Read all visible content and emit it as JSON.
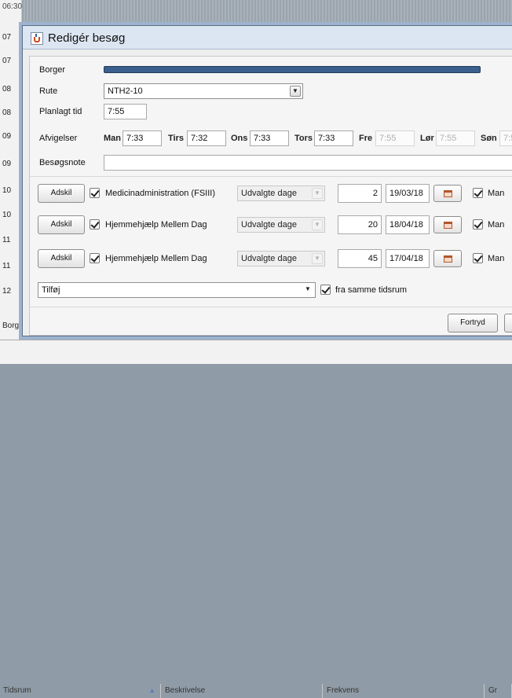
{
  "background": {
    "times": [
      "06:30",
      "07",
      "07",
      "08",
      "08",
      "09",
      "09",
      "10",
      "10",
      "11",
      "11",
      "12",
      "Borg"
    ],
    "table_headers": [
      "Tidsrum",
      "Beskrivelse",
      "Frekvens",
      "Gr"
    ]
  },
  "dialog": {
    "title": "Redigér besøg",
    "labels": {
      "borger": "Borger",
      "rute": "Rute",
      "planlagt": "Planlagt tid",
      "afvigelser": "Afvigelser",
      "note": "Besøgsnote"
    },
    "rute_value": "NTH2-10",
    "planlagt_value": "7:55",
    "deviations": [
      {
        "day": "Man",
        "time": "7:33",
        "enabled": true
      },
      {
        "day": "Tirs",
        "time": "7:32",
        "enabled": true
      },
      {
        "day": "Ons",
        "time": "7:33",
        "enabled": true
      },
      {
        "day": "Tors",
        "time": "7:33",
        "enabled": true
      },
      {
        "day": "Fre",
        "time": "7:55",
        "enabled": false
      },
      {
        "day": "Lør",
        "time": "7:55",
        "enabled": false
      },
      {
        "day": "Søn",
        "time": "7:5",
        "enabled": false
      }
    ],
    "note_value": "",
    "tasks": [
      {
        "button": "Adskil",
        "checked": true,
        "name": "Medicinadministration (FSIII)",
        "frequency": "Udvalgte dage",
        "count": "2",
        "date": "19/03/18",
        "day_checked": true,
        "day": "Man"
      },
      {
        "button": "Adskil",
        "checked": true,
        "name": "Hjemmehjælp Mellem Dag",
        "frequency": "Udvalgte dage",
        "count": "20",
        "date": "18/04/18",
        "day_checked": true,
        "day": "Man"
      },
      {
        "button": "Adskil",
        "checked": true,
        "name": "Hjemmehjælp Mellem Dag",
        "frequency": "Udvalgte dage",
        "count": "45",
        "date": "17/04/18",
        "day_checked": true,
        "day": "Man"
      }
    ],
    "add_combo": "Tilføj",
    "same_timespan_label": "fra samme tidsrum",
    "same_timespan_checked": true,
    "cancel_label": "Fortryd"
  }
}
